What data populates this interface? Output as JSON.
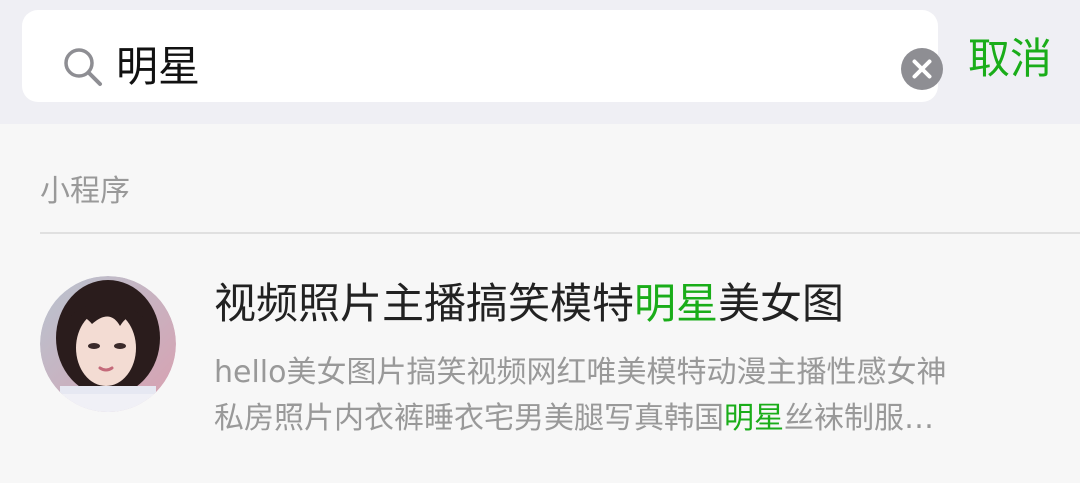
{
  "search": {
    "query": "明星",
    "cancel_label": "取消"
  },
  "section": {
    "label": "小程序"
  },
  "result": {
    "title_before": "视频照片主播搞笑模特",
    "title_highlight": "明星",
    "title_after": "美女图",
    "desc_line1": "hello美女图片搞笑视频网红唯美模特动漫主播性感女神",
    "desc_line2_before": "私房照片内衣裤睡衣宅男美腿写真韩国",
    "desc_line2_highlight": "明星",
    "desc_line2_after": "丝袜制服…"
  },
  "colors": {
    "accent": "#1aad19",
    "header_bg": "#efeff4",
    "secondary_text": "#999999"
  },
  "icons": {
    "search": "search-icon",
    "clear": "clear-icon"
  }
}
